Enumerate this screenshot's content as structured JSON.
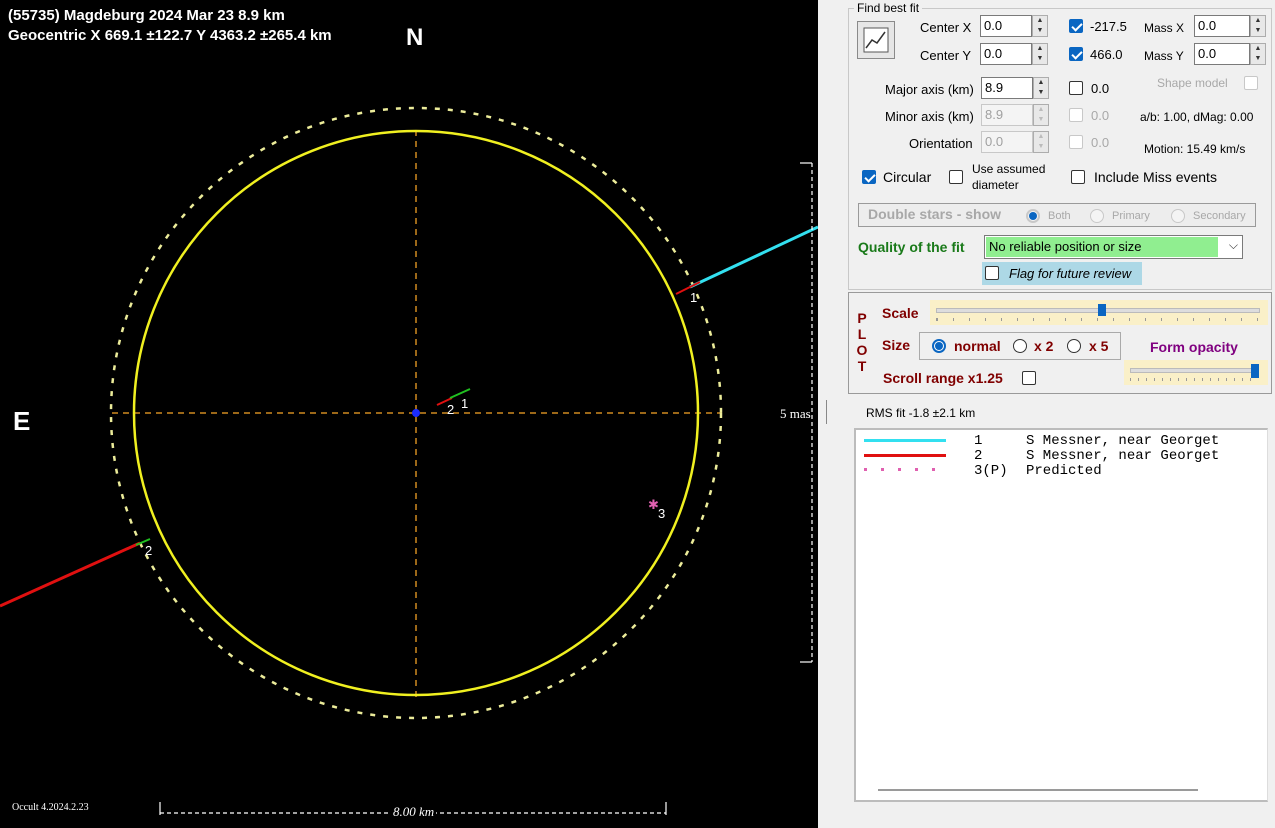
{
  "plot": {
    "title_line1": "(55735) Magdeburg  2024 Mar 23   8.9 km",
    "title_line2": "Geocentric  X  669.1 ±122.7  Y 4363.2 ±265.4 km",
    "north": "N",
    "east": "E",
    "mas_scale": "5 mas",
    "km_scale": "8.00 km",
    "version": "Occult 4.2024.2.23",
    "chord_labels": [
      "1",
      "2",
      "1",
      "2",
      "3"
    ]
  },
  "fit": {
    "group_title": "Find best fit",
    "center_x_label": "Center X",
    "center_x_value": "0.0",
    "center_y_label": "Center Y",
    "center_y_value": "0.0",
    "center_x_check_value": "-217.5",
    "center_y_check_value": "466.0",
    "mass_x_label": "Mass X",
    "mass_x_value": "0.0",
    "mass_y_label": "Mass Y",
    "mass_y_value": "0.0",
    "major_label": "Major axis (km)",
    "major_value": "8.9",
    "major_check_value": "0.0",
    "minor_label": "Minor axis (km)",
    "minor_value": "8.9",
    "minor_check_value": "0.0",
    "orient_label": "Orientation",
    "orient_value": "0.0",
    "orient_check_value": "0.0",
    "shape_model": "Shape model",
    "ab_text": "a/b: 1.00, dMag: 0.00",
    "motion_text": "Motion: 15.49 km/s",
    "circular_label": "Circular",
    "assumed_label_1": "Use assumed",
    "assumed_label_2": "diameter",
    "miss_label": "Include Miss events",
    "double_stars": "Double stars - show",
    "both": "Both",
    "primary": "Primary",
    "secondary": "Secondary",
    "quality_label": "Quality of the fit",
    "quality_value": "No reliable position or size",
    "flag_label": "Flag for future review"
  },
  "plotctl": {
    "plot_letters": [
      "P",
      "L",
      "O",
      "T"
    ],
    "scale_label": "Scale",
    "size_label": "Size",
    "size_normal": "normal",
    "size_x2": "x 2",
    "size_x5": "x 5",
    "scroll_label": "Scroll range x1.25",
    "form_opacity": "Form opacity"
  },
  "rms": "RMS fit -1.8 ±2.1 km",
  "legend": [
    {
      "num": "1",
      "text": "S Messner, near Georget",
      "color": "#33e0f0"
    },
    {
      "num": "2",
      "text": "S Messner, near Georget",
      "color": "#e01010"
    },
    {
      "num": "3(P)",
      "text": "Predicted",
      "color": "#e060b0"
    }
  ]
}
